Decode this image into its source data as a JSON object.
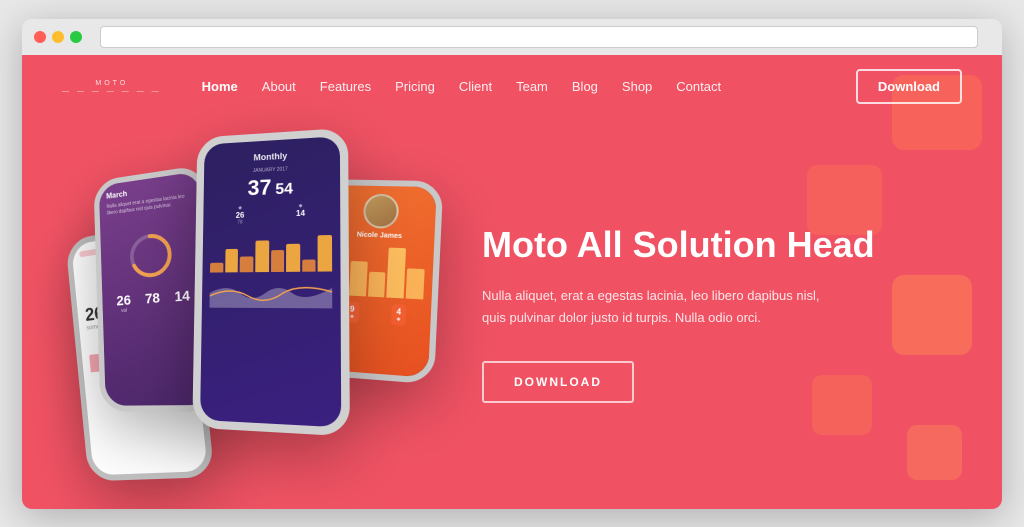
{
  "browser": {
    "url": ""
  },
  "navbar": {
    "logo": "MOTO",
    "logo_sub": "— — — — — — —",
    "links": [
      {
        "label": "Home",
        "active": true
      },
      {
        "label": "About"
      },
      {
        "label": "Features"
      },
      {
        "label": "Pricing"
      },
      {
        "label": "Client"
      },
      {
        "label": "Team"
      },
      {
        "label": "Blog"
      },
      {
        "label": "Shop"
      },
      {
        "label": "Contact"
      }
    ],
    "download_btn": "Download"
  },
  "hero": {
    "title": "Moto All Solution Head",
    "subtitle": "Nulla aliquet, erat a egestas lacinia, leo libero dapibus nisl, quis pulvinar dolor justo id turpis. Nulla odio orci.",
    "cta_label": "DOWNLOAD"
  },
  "colors": {
    "bg": "#f05263",
    "deco_sq": "rgba(255,120,80,0.45)"
  }
}
